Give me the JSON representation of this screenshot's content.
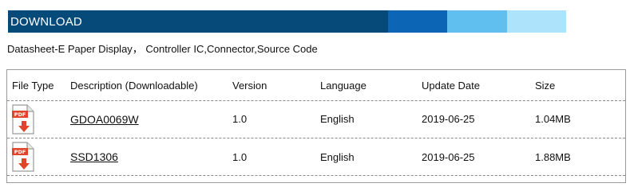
{
  "banner": {
    "title": "DOWNLOAD",
    "colors": [
      "#064a7a",
      "#0c66b5",
      "#61bff0",
      "#ade4fb"
    ]
  },
  "subtitle": "Datasheet-E Paper Display， Controller IC,Connector,Source Code",
  "table": {
    "headers": [
      "File Type",
      "Description (Downloadable)",
      "Version",
      "Language",
      "Update Date",
      "Size"
    ],
    "rows": [
      {
        "file_type_icon": "pdf-file-icon",
        "icon_label": "PDF",
        "description": "GDOA0069W",
        "version": "1.0",
        "language": "English",
        "update_date": "2019-06-25",
        "size": "1.04MB"
      },
      {
        "file_type_icon": "pdf-file-icon",
        "icon_label": "PDF",
        "description": "SSD1306",
        "version": "1.0",
        "language": "English",
        "update_date": "2019-06-25",
        "size": "1.88MB"
      }
    ]
  }
}
